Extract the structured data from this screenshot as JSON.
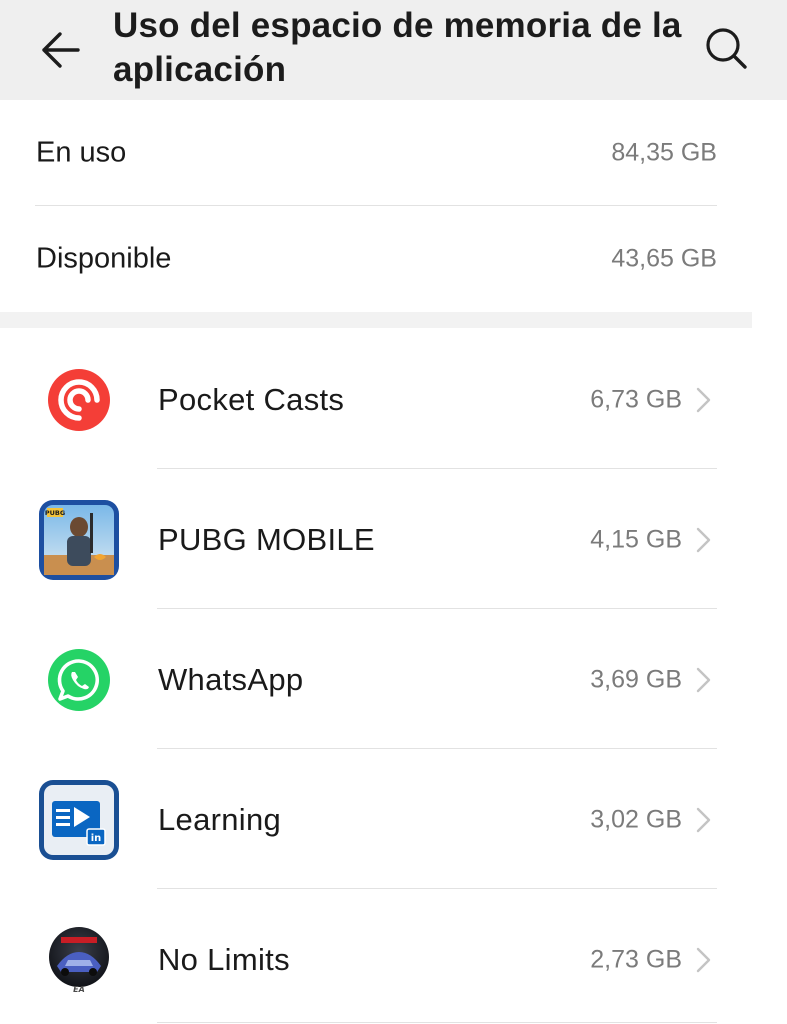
{
  "header": {
    "title": "Uso del espacio de memoria de la aplicación",
    "back_icon": "arrow-left-icon",
    "search_icon": "search-icon"
  },
  "summary": {
    "in_use_label": "En uso",
    "in_use_value": "84,35 GB",
    "available_label": "Disponible",
    "available_value": "43,65 GB"
  },
  "apps": [
    {
      "name": "Pocket Casts",
      "size": "6,73 GB",
      "icon": "pocket-casts-icon"
    },
    {
      "name": "PUBG MOBILE",
      "size": "4,15 GB",
      "icon": "pubg-mobile-icon",
      "icon_badge": "PUBG"
    },
    {
      "name": "WhatsApp",
      "size": "3,69 GB",
      "icon": "whatsapp-icon"
    },
    {
      "name": "Learning",
      "size": "3,02 GB",
      "icon": "linkedin-learning-icon",
      "icon_badge": "in"
    },
    {
      "name": "No Limits",
      "size": "2,73 GB",
      "icon": "need-for-speed-no-limits-icon",
      "icon_badge": "EA"
    }
  ],
  "colors": {
    "header_bg": "#efefef",
    "pocket_casts": "#f43e37",
    "whatsapp": "#25d366",
    "secondary_text": "#7b7b7b"
  }
}
